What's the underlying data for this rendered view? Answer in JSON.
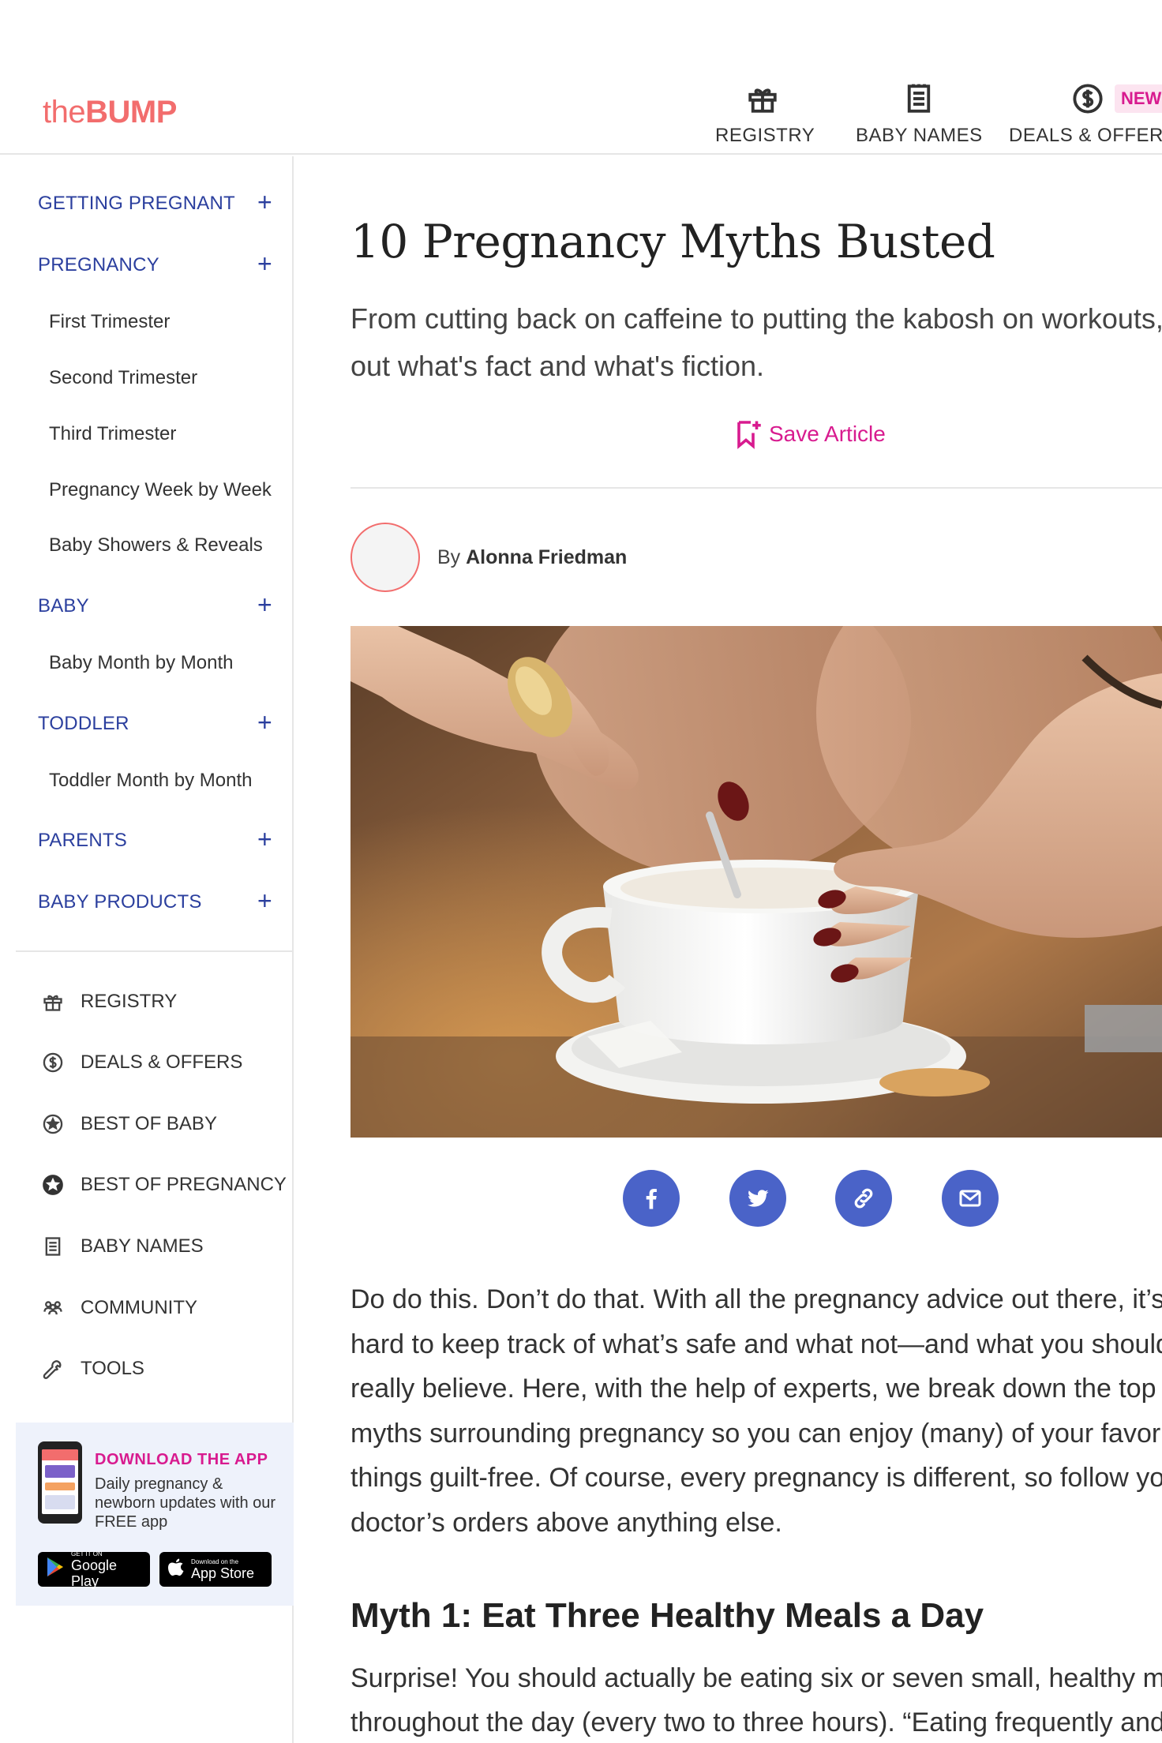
{
  "header": {
    "logo_the": "the",
    "logo_bump": "BUMP",
    "nav": [
      {
        "label": "REGISTRY",
        "icon": "gift-icon"
      },
      {
        "label": "BABY NAMES",
        "icon": "notepad-icon"
      },
      {
        "label": "DEALS & OFFERS",
        "icon": "dollar-circle-icon"
      }
    ],
    "new_badge": "NEW!"
  },
  "sidebar": {
    "categories": [
      {
        "label": "GETTING PREGNANT"
      },
      {
        "label": "PREGNANCY",
        "items": [
          "First Trimester",
          "Second Trimester",
          "Third Trimester",
          "Pregnancy Week by Week",
          "Baby Showers & Reveals"
        ]
      },
      {
        "label": "BABY",
        "items": [
          "Baby Month by Month"
        ]
      },
      {
        "label": "TODDLER",
        "items": [
          "Toddler Month by Month"
        ]
      },
      {
        "label": "PARENTS"
      },
      {
        "label": "BABY PRODUCTS"
      }
    ],
    "tools": [
      {
        "label": "REGISTRY",
        "icon": "gift-icon"
      },
      {
        "label": "DEALS & OFFERS",
        "icon": "dollar-circle-icon"
      },
      {
        "label": "BEST OF BABY",
        "icon": "star-badge-icon"
      },
      {
        "label": "BEST OF PREGNANCY",
        "icon": "star-badge-filled-icon"
      },
      {
        "label": "BABY NAMES",
        "icon": "notepad-icon"
      },
      {
        "label": "COMMUNITY",
        "icon": "people-icon"
      },
      {
        "label": "TOOLS",
        "icon": "wrench-icon"
      }
    ],
    "app_promo": {
      "title": "DOWNLOAD THE APP",
      "desc": "Daily pregnancy & newborn updates with our FREE app",
      "google_small": "GET IT ON",
      "google_big": "Google Play",
      "apple_small": "Download on the",
      "apple_big": "App Store"
    }
  },
  "article": {
    "title": "10 Pregnancy Myths Busted",
    "dek": "From cutting back on caffeine to putting the kabosh on workouts, find out what's fact and what's fiction.",
    "save_label": "Save Article",
    "byline_prefix": "By ",
    "author": "Alonna Friedman",
    "hero_alt": "Hands stirring a cup of coffee",
    "share": [
      "facebook-icon",
      "twitter-icon",
      "link-icon",
      "email-icon"
    ],
    "intro": "Do do this. Don’t do that. With all the pregnancy advice out there, it’s hard to keep track of what’s safe and what not—and what you should really believe. Here, with the help of experts, we break down the top 10 myths surrounding pregnancy so you can enjoy (many) of your favorite things guilt-free. Of course, every pregnancy is different, so follow your doctor’s orders above anything else.",
    "myth1_heading": "Myth 1: Eat Three Healthy Meals a Day",
    "myth1_text": "Surprise! You should actually be eating six or seven small, healthy meals throughout the day (every two to three hours). “Eating frequently and"
  },
  "colors": {
    "brand_coral": "#f26d6d",
    "nav_blue": "#2b3f9e",
    "accent_pink": "#d81b8f",
    "share_blue": "#4a63c8"
  }
}
